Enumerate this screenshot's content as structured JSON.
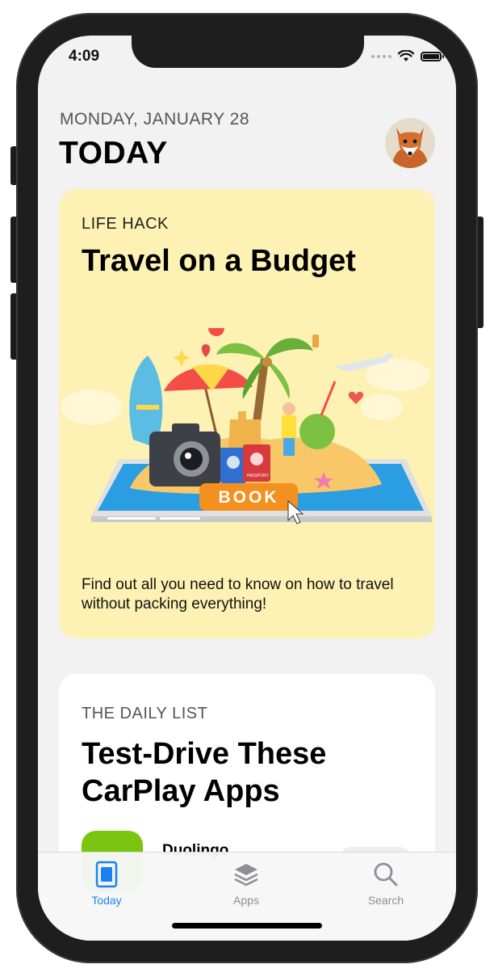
{
  "status_bar": {
    "time": "4:09"
  },
  "header": {
    "date": "MONDAY, JANUARY 28",
    "title": "TODAY"
  },
  "cards": [
    {
      "eyebrow": "LIFE HACK",
      "title": "Travel on a Budget",
      "description": "Find out all you need to know on how to travel without packing everything!",
      "illustration_button": "BOOK",
      "passport_text": "PASSPORT",
      "background_color": "#fdf2b3"
    },
    {
      "eyebrow": "THE DAILY LIST",
      "title": "Test-Drive These CarPlay Apps",
      "app_name": "Duolingo"
    }
  ],
  "tabbar": {
    "tabs": [
      {
        "label": "Today",
        "icon": "today-icon",
        "active": true
      },
      {
        "label": "Apps",
        "icon": "apps-stack-icon",
        "active": false
      },
      {
        "label": "Search",
        "icon": "search-icon",
        "active": false
      }
    ],
    "active_color": "#1a82f0",
    "inactive_color": "#8e8e93"
  }
}
